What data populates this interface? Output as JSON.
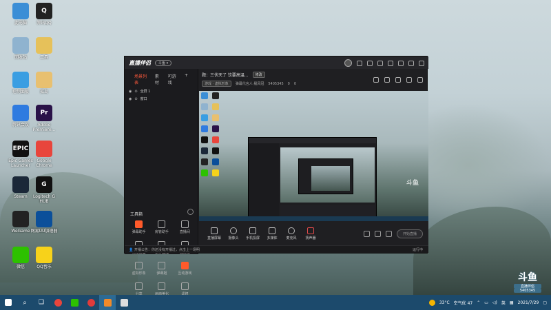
{
  "desktop_icons": [
    {
      "label": "此电脑",
      "color": "#3b8ed6",
      "glyph": ""
    },
    {
      "label": "腾讯QQ",
      "color": "#222222",
      "glyph": "Q"
    },
    {
      "label": "回收站",
      "color": "#8fb3cf",
      "glyph": ""
    },
    {
      "label": "工具",
      "color": "#e6c15a",
      "glyph": ""
    },
    {
      "label": "控制面板",
      "color": "#3a9ee2",
      "glyph": ""
    },
    {
      "label": "孤岛",
      "color": "#e8c070",
      "glyph": ""
    },
    {
      "label": "腾讯会议",
      "color": "#2f7be0",
      "glyph": ""
    },
    {
      "label": "Adobe Premiere...",
      "color": "#2a1248",
      "glyph": "Pr"
    },
    {
      "label": "Epic Games Launcher",
      "color": "#111111",
      "glyph": "EPIC"
    },
    {
      "label": "Google Chrome",
      "color": "#e8453c",
      "glyph": ""
    },
    {
      "label": "Steam",
      "color": "#1b2838",
      "glyph": ""
    },
    {
      "label": "Logitech G HUB",
      "color": "#111111",
      "glyph": "G"
    },
    {
      "label": "WeGame",
      "color": "#222222",
      "glyph": ""
    },
    {
      "label": "网易UU加速器",
      "color": "#0b4f9a",
      "glyph": ""
    },
    {
      "label": "微信",
      "color": "#2dc100",
      "glyph": ""
    },
    {
      "label": "QQ音乐",
      "color": "#f7d21a",
      "glyph": ""
    }
  ],
  "window": {
    "logo": "直播伴侣",
    "logo_pill": "斗鱼 ▾",
    "tabs": [
      "场景列表",
      "素材",
      "可游戏"
    ],
    "tab_add": "+",
    "scenes": [
      {
        "label": "全屏 1",
        "eye": "◉",
        "lock": "⊙"
      },
      {
        "label": "窗口",
        "eye": "◉",
        "lock": "⊙"
      }
    ],
    "tools_title": "工具箱",
    "tools": [
      {
        "label": "弹幕助手",
        "hot": true
      },
      {
        "label": "房管助手",
        "hot": false
      },
      {
        "label": "直播间",
        "hot": false
      },
      {
        "label": "礼物设置",
        "hot": false
      },
      {
        "label": "多开直播",
        "hot": false
      },
      {
        "label": "媒体库",
        "hot": false
      },
      {
        "label": "虚拟形象",
        "hot": false
      },
      {
        "label": "弹幕姬",
        "hot": false
      },
      {
        "label": "互动游戏",
        "hot": true
      },
      {
        "label": "分享",
        "hot": false
      },
      {
        "label": "画面美化",
        "hot": false
      },
      {
        "label": "滤镜",
        "hot": false
      }
    ],
    "notice": "👤 开播公告：你还没有开播过，点击上一场明",
    "notice_right": "运行中",
    "main": {
      "title": "题：三伏天了 饮要高温...",
      "title_btn": "修改",
      "category_btn": "游戏 · 虚拟形象",
      "meta": [
        "弹幕代言人·晨风冠",
        "5405345",
        "0",
        "0"
      ]
    },
    "controls": [
      {
        "label": "直播屏幕"
      },
      {
        "label": "摄像头"
      },
      {
        "label": "手机投屏"
      },
      {
        "label": "多媒体"
      },
      {
        "label": "麦克风"
      },
      {
        "label": "扬声器"
      }
    ],
    "live_button": "开始直播",
    "watermark": "斗鱼"
  },
  "taskbar": {
    "temp": "33°C",
    "air": "空气优 47",
    "ime": "英",
    "time": "",
    "date": "2021/7/29"
  },
  "douyu_badge": {
    "big": "斗鱼",
    "small": "直播伴侣",
    "room": "5405345"
  }
}
